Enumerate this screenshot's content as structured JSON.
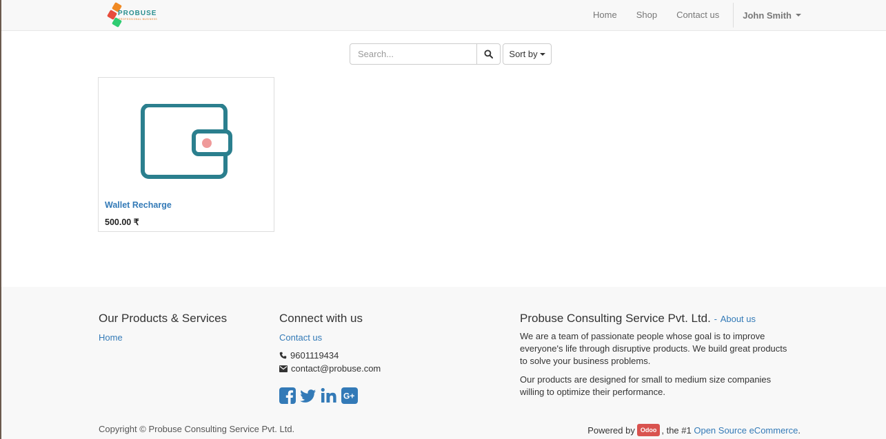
{
  "brand": {
    "name": "PROBUSE",
    "tagline": "PROFESSIONAL BUSINESS",
    "colors": {
      "orange": "#f08a24",
      "red": "#e74c3c",
      "green": "#2ecc71",
      "teal": "#2a8f8f"
    }
  },
  "nav": {
    "items": [
      {
        "label": "Home"
      },
      {
        "label": "Shop"
      },
      {
        "label": "Contact us"
      }
    ],
    "user": "John Smith"
  },
  "search": {
    "placeholder": "Search...",
    "value": "",
    "icon": "search-icon"
  },
  "sort": {
    "label": "Sort by"
  },
  "products": [
    {
      "name": "Wallet Recharge",
      "price": "500.00 ₹",
      "icon": "wallet-icon"
    }
  ],
  "footer": {
    "products_title": "Our Products & Services",
    "products_links": [
      "Home"
    ],
    "connect_title": "Connect with us",
    "connect_link": "Contact us",
    "phone": "9601119434",
    "email": "contact@probuse.com",
    "socials": [
      "facebook-icon",
      "twitter-icon",
      "linkedin-icon",
      "google-plus-icon"
    ],
    "company_title": "Probuse Consulting Service Pvt. Ltd.",
    "about_link": "About us",
    "about_text_1": "We are a team of passionate people whose goal is to improve everyone's life through disruptive products. We build great products to solve your business problems.",
    "about_text_2": "Our products are designed for small to medium size companies willing to optimize their performance.",
    "copyright": "Copyright © Probuse Consulting Service Pvt. Ltd.",
    "powered_prefix": "Powered by",
    "powered_badge": "Odoo",
    "powered_middle": ", the #1",
    "powered_link": "Open Source eCommerce",
    "powered_suffix": "."
  },
  "accent_color": "#337ab7"
}
